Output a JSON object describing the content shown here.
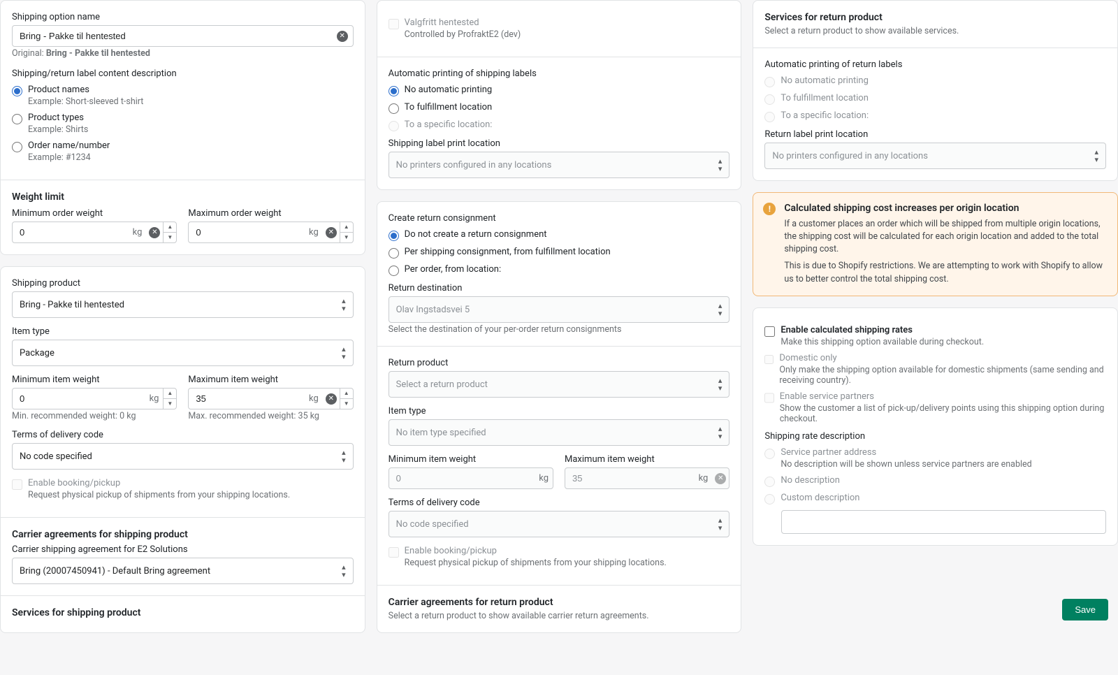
{
  "col1": {
    "shipping_option_name_label": "Shipping option name",
    "shipping_option_name_value": "Bring - Pakke til hentested",
    "original_prefix": "Original: ",
    "original_value": "Bring - Pakke til hentested",
    "label_content_desc": "Shipping/return label content description",
    "radio_product_names": "Product names",
    "radio_product_names_ex": "Example: Short-sleeved t-shirt",
    "radio_product_types": "Product types",
    "radio_product_types_ex": "Example: Shirts",
    "radio_order_name": "Order name/number",
    "radio_order_name_ex": "Example: #1234",
    "weight_limit_heading": "Weight limit",
    "min_order_weight_label": "Minimum order weight",
    "min_order_weight_value": "0",
    "max_order_weight_label": "Maximum order weight",
    "max_order_weight_value": "0",
    "kg": "kg",
    "shipping_product_label": "Shipping product",
    "shipping_product_value": "Bring - Pakke til hentested",
    "item_type_label": "Item type",
    "item_type_value": "Package",
    "min_item_weight_label": "Minimum item weight",
    "min_item_weight_value": "0",
    "max_item_weight_label": "Maximum item weight",
    "max_item_weight_value": "35",
    "min_reco": "Min. recommended weight: 0 kg",
    "max_reco": "Max. recommended weight: 35 kg",
    "terms_label": "Terms of delivery code",
    "terms_value": "No code specified",
    "enable_booking": "Enable booking/pickup",
    "enable_booking_sub": "Request physical pickup of shipments from your shipping locations.",
    "carrier_agreements_heading": "Carrier agreements for shipping product",
    "carrier_agreement_label": "Carrier shipping agreement for E2 Solutions",
    "carrier_agreement_value": "Bring (20007450941) - Default Bring agreement",
    "services_heading": "Services for shipping product"
  },
  "col2": {
    "valgfritt": "Valgfritt hentested",
    "valgfritt_sub": "Controlled by ProfraktE2 (dev)",
    "auto_print_heading": "Automatic printing of shipping labels",
    "r_no_auto": "No automatic printing",
    "r_to_fulfill": "To fulfillment location",
    "r_to_specific": "To a specific location:",
    "print_location_label": "Shipping label print location",
    "print_location_value": "No printers configured in any locations",
    "return_consign_heading": "Create return consignment",
    "rc_no": "Do not create a return consignment",
    "rc_per_ship": "Per shipping consignment, from fulfillment location",
    "rc_per_order": "Per order, from location:",
    "return_dest_label": "Return destination",
    "return_dest_value": "Olav Ingstadsvei 5",
    "return_dest_sub": "Select the destination of your per-order return consignments",
    "return_product_label": "Return product",
    "return_product_value": "Select a return product",
    "r_item_type_label": "Item type",
    "r_item_type_value": "No item type specified",
    "r_min_item_weight_label": "Minimum item weight",
    "r_min_item_weight_value": "0",
    "r_max_item_weight_label": "Maximum item weight",
    "r_max_item_weight_value": "35",
    "r_terms_label": "Terms of delivery code",
    "r_terms_value": "No code specified",
    "r_enable_booking": "Enable booking/pickup",
    "r_enable_booking_sub": "Request physical pickup of shipments from your shipping locations.",
    "r_carrier_heading": "Carrier agreements for return product",
    "r_carrier_sub": "Select a return product to show available carrier return agreements."
  },
  "col3": {
    "services_return_heading": "Services for return product",
    "services_return_sub": "Select a return product to show available services.",
    "auto_print_return_heading": "Automatic printing of return labels",
    "r_no_auto": "No automatic printing",
    "r_to_fulfill": "To fulfillment location",
    "r_to_specific": "To a specific location:",
    "return_print_loc_label": "Return label print location",
    "return_print_loc_value": "No printers configured in any locations",
    "banner_heading": "Calculated shipping cost increases per origin location",
    "banner_p1": "If a customer places an order which will be shipped from multiple origin locations, the shipping cost will be calculated for each origin location and added to the total shipping cost.",
    "banner_p2": "This is due to Shopify restrictions. We are attempting to work with Shopify to allow us to better control the total shipping cost.",
    "enable_calc": "Enable calculated shipping rates",
    "enable_calc_sub": "Make this shipping option available during checkout.",
    "domestic_only": "Domestic only",
    "domestic_only_sub": "Only make the shipping option available for domestic shipments (same sending and receiving country).",
    "enable_partners": "Enable service partners",
    "enable_partners_sub": "Show the customer a list of pick-up/delivery points using this shipping option during checkout.",
    "rate_desc_label": "Shipping rate description",
    "rd_partner": "Service partner address",
    "rd_partner_sub": "No description will be shown unless service partners are enabled",
    "rd_none": "No description",
    "rd_custom": "Custom description"
  },
  "save": "Save",
  "kg": "kg"
}
